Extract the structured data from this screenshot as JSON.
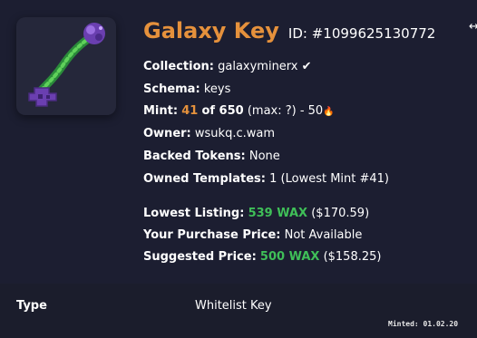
{
  "asset": {
    "name": "Galaxy Key",
    "id_text": "ID: #1099625130772",
    "edge_glyph": "↔"
  },
  "details": {
    "collection_label": "Collection:",
    "collection_value": "galaxyminerx",
    "collection_verified_icon": "✔",
    "schema_label": "Schema:",
    "schema_value": "keys",
    "mint_label": "Mint:",
    "mint_number": "41",
    "mint_of": "of 650",
    "mint_extra": "(max: ?) - 50",
    "mint_icon": "🔥",
    "owner_label": "Owner:",
    "owner_value": "wsukq.c.wam",
    "backed_label": "Backed Tokens:",
    "backed_value": "None",
    "templates_label": "Owned Templates:",
    "templates_value": "1 (Lowest Mint #41)",
    "lowest_label": "Lowest Listing:",
    "lowest_wax": "539 WAX",
    "lowest_usd": "($170.59)",
    "purchase_label": "Your Purchase Price:",
    "purchase_value": "Not Available",
    "suggested_label": "Suggested Price:",
    "suggested_wax": "500 WAX",
    "suggested_usd": "($158.25)"
  },
  "attributes": {
    "type_label": "Type",
    "type_value": "Whitelist Key"
  },
  "minted_text": "Minted: 01.02.20",
  "colors": {
    "accent_orange": "#e5913c",
    "price_green": "#3fbf58",
    "background": "#1c1e31"
  },
  "icons": [
    "galaxy-key-image",
    "verified-check-icon",
    "flame-icon"
  ]
}
